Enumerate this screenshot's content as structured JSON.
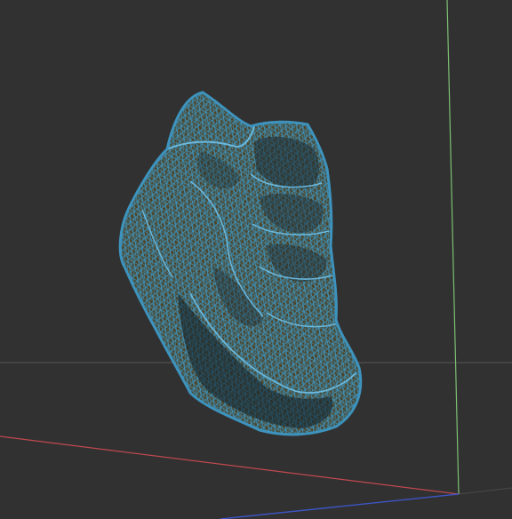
{
  "viewport": {
    "background_color": "#313131",
    "view_mode": "wireframe",
    "mesh_color": "#3d93bd",
    "mesh_fill_color": "#4d4428"
  },
  "scene": {
    "axes": {
      "x_axis_color": "#c0494f",
      "y_axis_color": "#7dbf73",
      "z_axis_color": "#3d55c4",
      "grid_line_color": "#585858"
    },
    "object": {
      "icon": "rock-mesh-icon"
    }
  }
}
